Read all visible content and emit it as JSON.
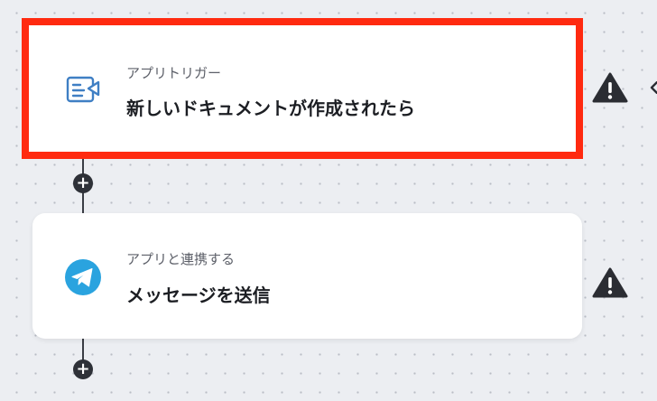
{
  "flow": {
    "steps": [
      {
        "kind": "アプリトリガー",
        "title": "新しいドキュメントが作成されたら",
        "icon": "document-trigger-icon",
        "warning": true
      },
      {
        "kind": "アプリと連携する",
        "title": "メッセージを送信",
        "icon": "telegram-icon",
        "warning": true
      }
    ],
    "add_step_label": "+"
  },
  "colors": {
    "selection_outline": "#ff2a10",
    "card_background": "#ffffff",
    "canvas_background": "#eceef2",
    "warning": "#2b2d33",
    "trigger_icon": "#3f7fc4",
    "telegram_blue": "#2aa3df"
  }
}
